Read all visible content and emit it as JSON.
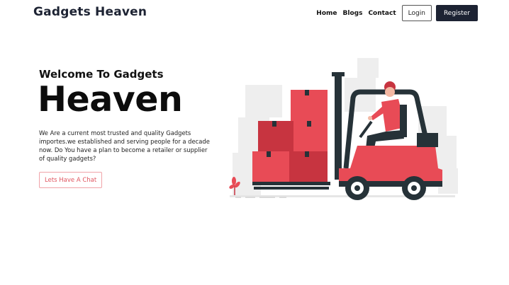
{
  "header": {
    "brand": "Gadgets Heaven",
    "nav": [
      "Home",
      "Blogs",
      "Contact"
    ],
    "login_label": "Login",
    "register_label": "Register"
  },
  "hero": {
    "subtitle": "Welcome To Gadgets",
    "title": "Heaven",
    "description": "We Are a current most trusted and quality Gadgets importes.we established and serving people for a decade now. Do You have a plan to become a retailer or supplier of quality gadgets?",
    "cta_label": "Lets Have A Chat"
  },
  "illustration": {
    "name": "forklift-illustration",
    "accent_color": "#e84b56",
    "dark_color": "#263238"
  }
}
